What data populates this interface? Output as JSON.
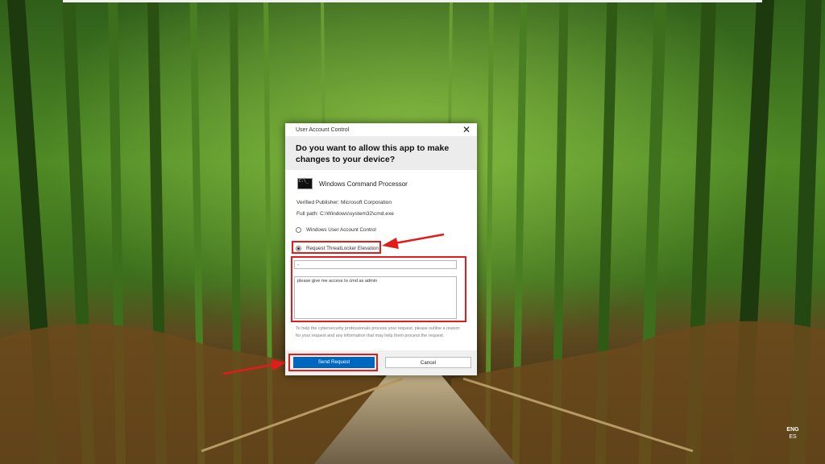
{
  "dialog": {
    "window_title": "User Account Control",
    "question": "Do you want to allow this app to make changes to your device?",
    "app_name": "Windows Command Processor",
    "app_icon_text": "C:\\_",
    "publisher_line": "Verified Publisher:  Microsoft Corporation",
    "path_line": "Full path:  C:\\Windows\\system32\\cmd.exe",
    "options": [
      {
        "label": "Windows User Account Control",
        "selected": false
      },
      {
        "label": "Request ThreatLocker Elevation",
        "selected": true
      }
    ],
    "input_value": "-",
    "reason_text": "please give me access to cmd as admin",
    "help_text": "To help the cybersecurity professionals process your request, please outline a reason for your request and any information that may help them process the request.",
    "send_button": "Send Request",
    "cancel_button": "Cancel"
  },
  "taskbar": {
    "language": "ENG",
    "layout": "ES"
  },
  "colors": {
    "accent": "#0067c0",
    "highlight": "#e21b1b"
  }
}
